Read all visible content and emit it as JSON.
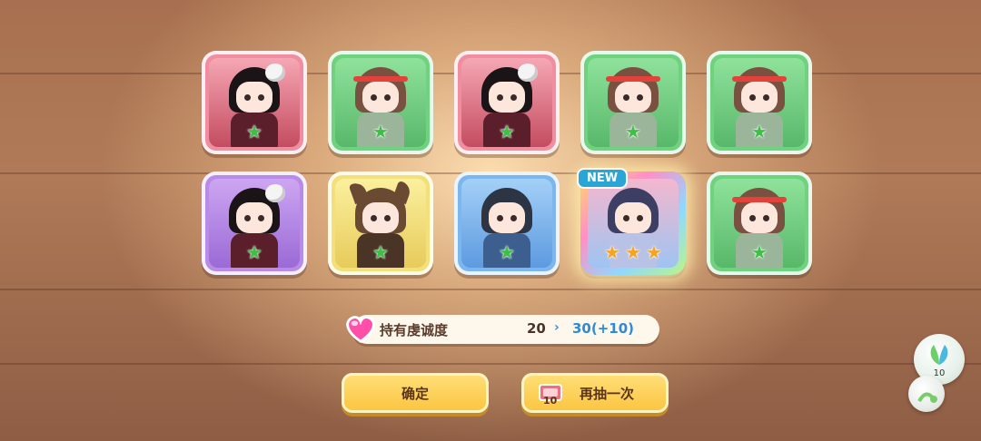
{
  "cards": [
    {
      "color": "pink",
      "character": "skull-girl",
      "stars": 1,
      "star_color": "green",
      "is_new": false
    },
    {
      "color": "green",
      "character": "headband-girl",
      "stars": 1,
      "star_color": "green",
      "is_new": false
    },
    {
      "color": "pink",
      "character": "skull-girl",
      "stars": 1,
      "star_color": "green",
      "is_new": false
    },
    {
      "color": "green",
      "character": "headband-girl",
      "stars": 1,
      "star_color": "green",
      "is_new": false
    },
    {
      "color": "green",
      "character": "headband-girl",
      "stars": 1,
      "star_color": "green",
      "is_new": false
    },
    {
      "color": "purple",
      "character": "skull-girl",
      "stars": 1,
      "star_color": "green",
      "is_new": false
    },
    {
      "color": "yellow",
      "character": "cat-ear-girl",
      "stars": 1,
      "star_color": "green",
      "is_new": false
    },
    {
      "color": "blue",
      "character": "dark-hair-girl",
      "stars": 1,
      "star_color": "green",
      "is_new": false
    },
    {
      "color": "rainbow",
      "character": "blue-hair-girl",
      "stars": 3,
      "star_color": "gold",
      "is_new": true
    },
    {
      "color": "green",
      "character": "headband-girl",
      "stars": 1,
      "star_color": "green",
      "is_new": false
    }
  ],
  "new_badge": "NEW",
  "devotion": {
    "label": "持有虔诚度",
    "current": "20",
    "arrow": "›",
    "next": "30(+10)",
    "icon": "heart-icon"
  },
  "buttons": {
    "confirm": "确定",
    "again": "再抽一次",
    "ticket_count": "10",
    "ticket_icon": "ticket-icon"
  },
  "side_widget": {
    "count": "10",
    "icon": "leaf-icon"
  }
}
